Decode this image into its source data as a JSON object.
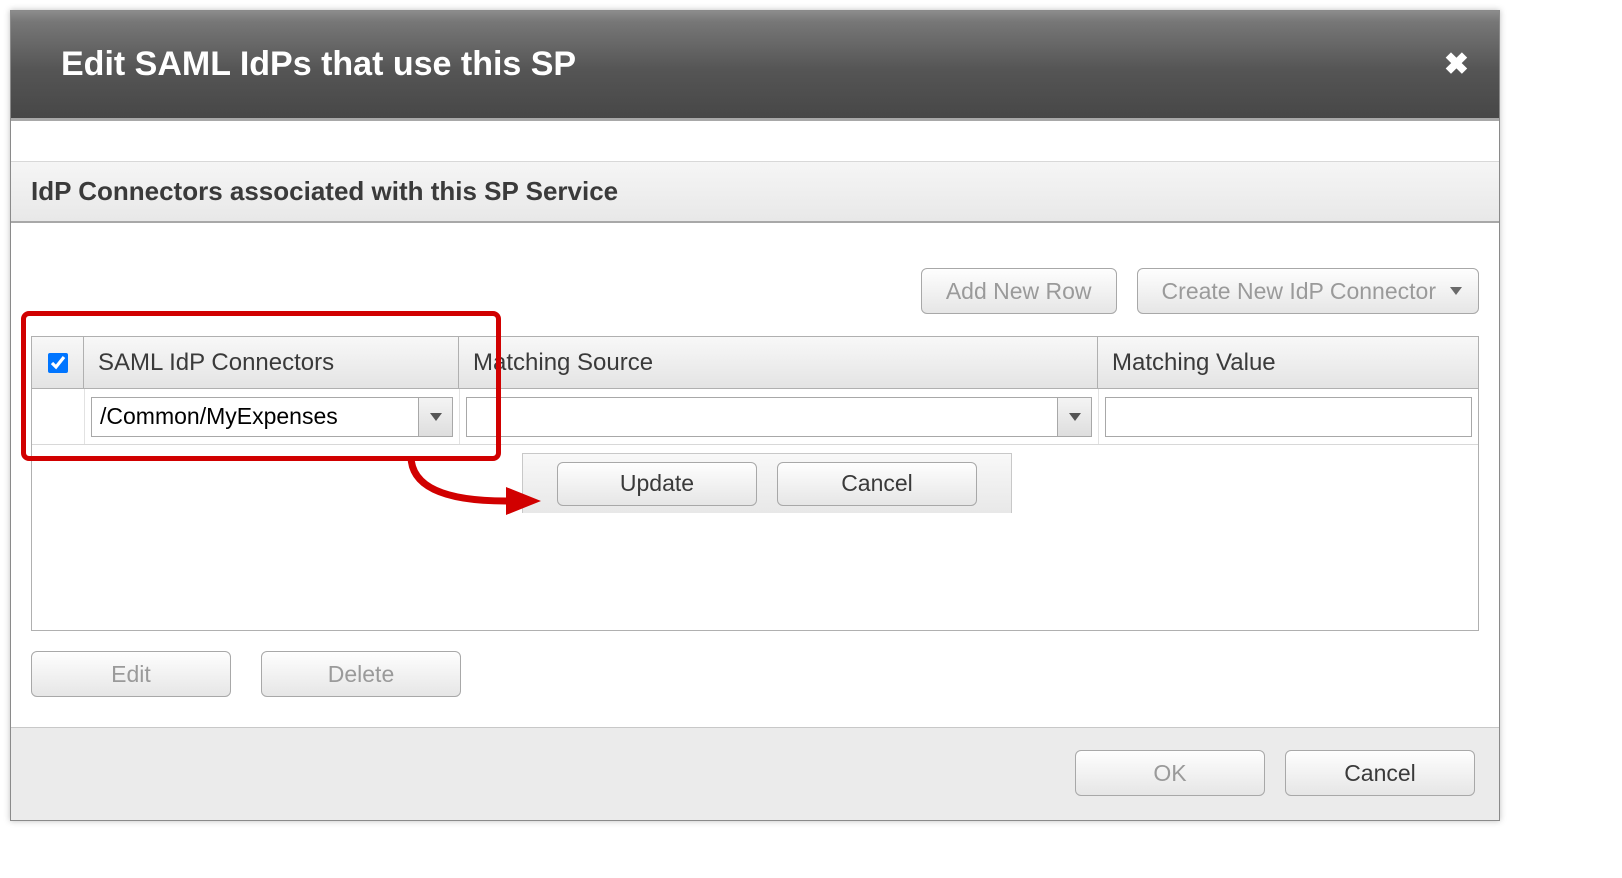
{
  "dialog": {
    "title": "Edit SAML IdPs that use this SP"
  },
  "section": {
    "heading": "IdP Connectors associated with this SP Service"
  },
  "toolbar": {
    "add_new_row": "Add New Row",
    "create_connector": "Create New IdP Connector"
  },
  "table": {
    "headers": {
      "connectors": "SAML IdP Connectors",
      "source": "Matching Source",
      "value": "Matching Value"
    },
    "row": {
      "connector_value": "/Common/MyExpenses",
      "source_value": "",
      "value_value": ""
    }
  },
  "row_actions": {
    "update": "Update",
    "cancel": "Cancel"
  },
  "bottom_actions": {
    "edit": "Edit",
    "delete": "Delete"
  },
  "footer": {
    "ok": "OK",
    "cancel": "Cancel"
  }
}
